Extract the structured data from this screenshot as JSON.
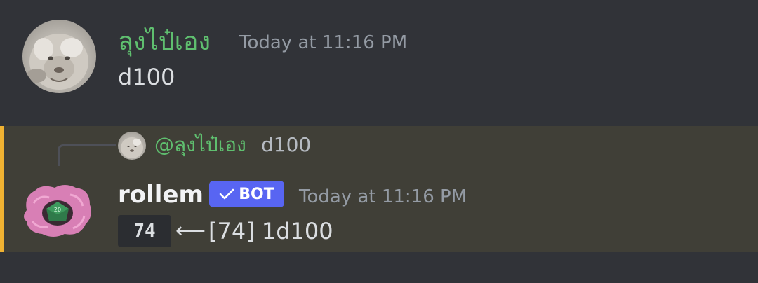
{
  "messages": [
    {
      "author": "ลุงไป๋เอง",
      "author_color": "#5fbf6f",
      "timestamp": "Today at 11:16 PM",
      "content": "d100",
      "avatar": "white-lion-avatar"
    },
    {
      "author": "rollem",
      "author_color": "#f2f3f5",
      "bot_tag": "BOT",
      "timestamp": "Today at 11:16 PM",
      "avatar": "pink-fluffy-dice-avatar",
      "mention_highlight_color": "#f0b232",
      "reply": {
        "author": "@ลุงไป๋เอง",
        "content": "d100"
      },
      "roll": {
        "result": "74",
        "arrow": "⟵",
        "detail": "[74] 1d100"
      }
    }
  ],
  "colors": {
    "background": "#313338",
    "highlight_background": "#403f37",
    "bot_tag": "#5865f2",
    "timestamp": "#949ba4"
  }
}
